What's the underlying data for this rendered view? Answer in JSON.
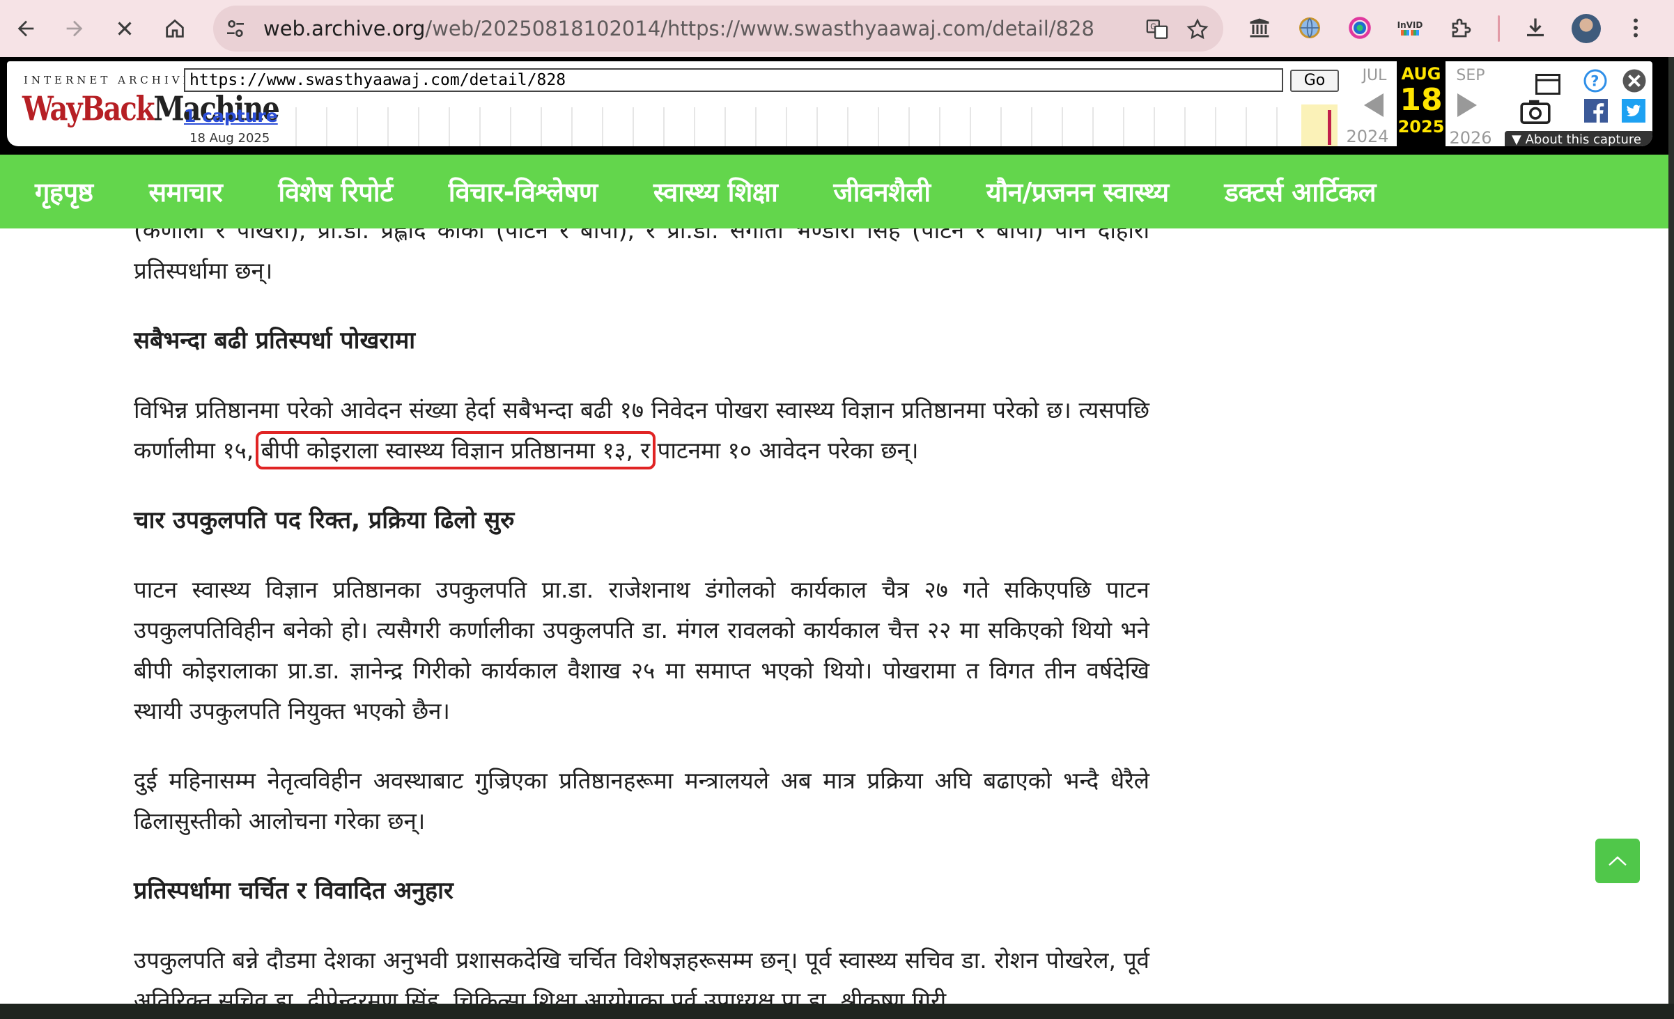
{
  "browser": {
    "url_host": "web.archive.org",
    "url_path": "/web/20250818102014/https://www.swasthyaawaj.com/detail/828",
    "icons": [
      "back-icon",
      "forward-icon",
      "stop-icon",
      "home-icon",
      "site-settings-icon",
      "translate-icon",
      "bookmark-star-icon",
      "archive-extension-icon",
      "globe-extension-icon",
      "color-extension-icon",
      "invid-extension-icon",
      "extensions-puzzle-icon",
      "download-icon",
      "menu-kebab-icon"
    ],
    "invid_label": "InVID"
  },
  "wayback": {
    "logo_top": "INTERNET ARCHIVE",
    "logo_main": "WayBack",
    "logo_suffix": "Machine",
    "url_value": "https://www.swasthyaawaj.com/detail/828",
    "go_label": "Go",
    "captures_link": "1 capture",
    "captures_date": "18 Aug 2025",
    "prev_month": "JUL",
    "cur_month": "AUG",
    "next_month": "SEP",
    "cur_day": "18",
    "prev_year": "2024",
    "cur_year": "2025",
    "next_year": "2026",
    "about_label": "About this capture"
  },
  "site_nav": {
    "items": [
      "गृहपृष्ठ",
      "समाचार",
      "विशेष रिपोर्ट",
      "विचार-विश्लेषण",
      "स्वास्थ्य शिक्षा",
      "जीवनशैली",
      "यौन/प्रजनन स्वास्थ्य",
      "डक्टर्स आर्टिकल"
    ],
    "color": "#63d64c"
  },
  "article": {
    "p0": "(कर्णाली र पोखरा), प्रा.डा. प्रह्लाद कार्की (पाटन र बीपी), र प्रा.डा. संगीता भण्डारी सिंह (पाटन र बीपी) पनि दोहोरो प्रतिस्पर्धामा छन्।",
    "h1": "सबैभन्दा बढी प्रतिस्पर्धा पोखरामा",
    "p1_a": "विभिन्न प्रतिष्ठानमा परेको आवेदन संख्या हेर्दा सबैभन्दा बढी १७ निवेदन पोखरा स्वास्थ्य विज्ञान प्रतिष्ठानमा परेको छ। त्यसपछि कर्णालीमा १५,",
    "p1_hl": "बीपी कोइराला स्वास्थ्य विज्ञान प्रतिष्ठानमा १३, र",
    "p1_b": " पाटनमा १० आवेदन परेका छन्।",
    "h2": "चार उपकुलपति पद रिक्त, प्रक्रिया ढिलो सुरु",
    "p2": "पाटन स्वास्थ्य विज्ञान प्रतिष्ठानका उपकुलपति प्रा.डा. राजेशनाथ डंगोलको कार्यकाल चैत्र २७ गते सकिएपछि पाटन उपकुलपतिविहीन बनेको हो। त्यसैगरी कर्णालीका उपकुलपति डा. मंगल रावलको कार्यकाल चैत्त २२ मा सकिएको थियो भने बीपी कोइरालाका प्रा.डा. ज्ञानेन्द्र गिरीको कार्यकाल वैशाख २५ मा समाप्त भएको थियो। पोखरामा त विगत तीन वर्षदेखि स्थायी उपकुलपति नियुक्त भएको छैन।",
    "p3": "दुई महिनासम्म नेतृत्वविहीन अवस्थाबाट गुज्रिएका प्रतिष्ठानहरूमा मन्त्रालयले अब मात्र प्रक्रिया अघि बढाएको भन्दै धेरैले ढिलासुस्तीको आलोचना गरेका छन्।",
    "h3": "प्रतिस्पर्धामा चर्चित र विवादित अनुहार",
    "p4": "उपकुलपति बन्ने दौडमा देशका अनुभवी प्रशासकदेखि चर्चित विशेषज्ञहरूसम्म छन्। पूर्व स्वास्थ्य सचिव डा. रोशन पोखरेल, पूर्व अतिरिक्त सचिव डा. दीपेन्द्ररमण सिंह, चिकित्सा शिक्षा आयोगका पूर्व उपाध्यक्ष प्रा.डा. श्रीकृष्ण गिरी,",
    "highlight_color": "#e02424"
  },
  "scroll_top": {
    "icon": "chevron-up-icon"
  }
}
